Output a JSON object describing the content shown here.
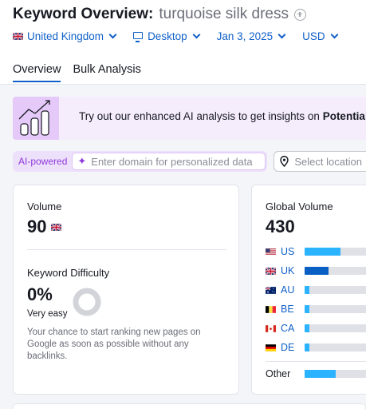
{
  "header": {
    "title": "Keyword Overview:",
    "keyword": "turquoise silk dress",
    "filters": {
      "database": "United Kingdom",
      "device": "Desktop",
      "date": "Jan 3, 2025",
      "currency": "USD"
    },
    "tabs": [
      {
        "label": "Overview",
        "active": true
      },
      {
        "label": "Bulk Analysis",
        "active": false
      }
    ]
  },
  "banner": {
    "text": "Try out our enhanced AI analysis to get insights on ",
    "bold": "Potential"
  },
  "ai": {
    "label": "AI-powered",
    "domain_placeholder": "Enter domain for personalized data",
    "location_placeholder": "Select location"
  },
  "volume": {
    "label": "Volume",
    "value": "90"
  },
  "keyword_difficulty": {
    "label": "Keyword Difficulty",
    "value": "0%",
    "level": "Very easy",
    "percent": 0,
    "description": "Your chance to start ranking new pages on Google as soon as possible without any backlinks."
  },
  "global_volume": {
    "label": "Global Volume",
    "value": "430",
    "countries": [
      {
        "code": "US",
        "share": 0.5
      },
      {
        "code": "UK",
        "share": 0.33,
        "highlight": true
      },
      {
        "code": "AU",
        "share": 0.07
      },
      {
        "code": "BE",
        "share": 0.07
      },
      {
        "code": "CA",
        "share": 0.07
      },
      {
        "code": "DE",
        "share": 0.07
      }
    ],
    "other_label": "Other",
    "other_share": 0.43
  },
  "colors": {
    "accent": "#1060c9",
    "bar_fill": "#2bb3ff",
    "bar_highlight": "#0a5fc4",
    "ai_purple": "#9039dc",
    "bar_track": "#dfe1e7"
  }
}
